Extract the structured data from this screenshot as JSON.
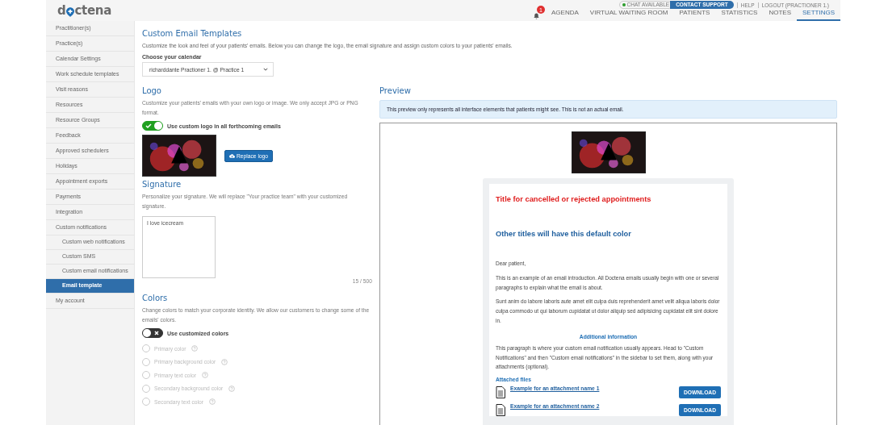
{
  "header": {
    "logo": {
      "left": "d",
      "right": "ctena"
    },
    "top_links": {
      "chat": "CHAT AVAILABLE",
      "chat_online": true,
      "support": "CONTACT SUPPORT",
      "help": "HELP",
      "logout": "LOGOUT (PRACTIONER 1.)"
    },
    "notifications": {
      "count": "1"
    },
    "tabs": [
      {
        "label": "AGENDA",
        "selected": false
      },
      {
        "label": "VIRTUAL WAITING ROOM",
        "selected": false
      },
      {
        "label": "PATIENTS",
        "selected": false
      },
      {
        "label": "STATISTICS",
        "selected": false
      },
      {
        "label": "NOTES",
        "selected": false
      },
      {
        "label": "SETTINGS",
        "selected": true
      }
    ]
  },
  "sidebar": {
    "items": [
      {
        "label": "Practitioner(s)",
        "selected": false
      },
      {
        "label": "Practice(s)",
        "selected": false
      },
      {
        "label": "Calendar Settings",
        "selected": false
      },
      {
        "label": "Work schedule templates",
        "selected": false
      },
      {
        "label": "Visit reasons",
        "selected": false
      },
      {
        "label": "Resources",
        "selected": false
      },
      {
        "label": "Resource Groups",
        "selected": false
      },
      {
        "label": "Feedback",
        "selected": false
      },
      {
        "label": "Approved schedulers",
        "selected": false
      },
      {
        "label": "Holidays",
        "selected": false
      },
      {
        "label": "Appointment exports",
        "selected": false
      },
      {
        "label": "Payments",
        "selected": false
      },
      {
        "label": "Integration",
        "selected": false
      },
      {
        "label": "Custom notifications",
        "selected": false,
        "children": [
          {
            "label": "Custom web notifications",
            "selected": false
          },
          {
            "label": "Custom SMS",
            "selected": false
          },
          {
            "label": "Custom email notifications",
            "selected": false
          },
          {
            "label": "Email template",
            "selected": true
          }
        ]
      },
      {
        "label": "My account",
        "selected": false
      }
    ]
  },
  "page": {
    "title": "Custom Email Templates",
    "description": "Customize the look and feel of your patients' emails. Below you can change the logo, the email signature and assign custom colors to your patients' emails.",
    "calendar": {
      "label": "Choose your calendar",
      "value": "richarddante Practioner 1. @ Practice 1"
    }
  },
  "logo_section": {
    "title": "Logo",
    "description": "Customize your patients' emails with your own logo or image. We only accept JPG or PNG format.",
    "toggle": {
      "label": "Use custom logo in all forthcoming emails",
      "on": true
    },
    "button": "Replace logo"
  },
  "signature": {
    "title": "Signature",
    "description": "Personalize your signature. We will replace \"Your practice team\" with your customized signature.",
    "value": "I love icecream",
    "counter": "15 / 500"
  },
  "colors": {
    "title": "Colors",
    "description": "Change colors to match your corporate identity. We allow our customers to change some of the emails' colors.",
    "toggle": {
      "label": "Use customized colors",
      "on": false
    },
    "options": [
      {
        "label": "Primary color",
        "selected": false,
        "disabled": true
      },
      {
        "label": "Primary background color",
        "selected": false,
        "disabled": true
      },
      {
        "label": "Primary text color",
        "selected": false,
        "disabled": true
      },
      {
        "label": "Secondary background color",
        "selected": false,
        "disabled": true
      },
      {
        "label": "Secondary text color",
        "selected": false,
        "disabled": true
      }
    ]
  },
  "preview": {
    "title": "Preview",
    "notice": "This preview only represents all interface elements that patients might see. This is not an actual email.",
    "email": {
      "alert_title": "Title for cancelled or rejected appointments",
      "default_title": "Other titles will have this default color",
      "greeting": "Dear patient,",
      "paragraphs": [
        "This is an example of an email introduction. All Doctena emails usually begin with one or several paragraphs to explain what the email is about.",
        "Sunt anim do labore laboris aute amet elit culpa duis reprehenderit amet velit aliqua laboris dolor culpa commodo ut qui laborum cupidatat ut dolor aliquip sed adipisicing cupidatat elit sint dolore in."
      ],
      "additional_title": "Additional information",
      "additional_text": "This paragraph is where your custom email notification usually appears. Head to \"Custom Notifications\" and then \"Custom email notifications\" in the sidebar to set them, along with your attachments (optional).",
      "attachments_title": "Attached files",
      "attachments": [
        {
          "name": "Example for an attachment name 1",
          "button": "DOWNLOAD"
        },
        {
          "name": "Example for an attachment name 2",
          "button": "DOWNLOAD"
        }
      ]
    }
  }
}
